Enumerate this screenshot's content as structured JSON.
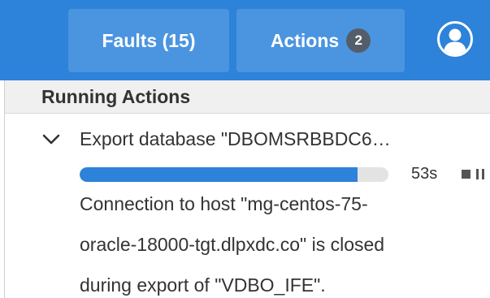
{
  "header": {
    "faults_label": "Faults (15)",
    "actions_label": "Actions",
    "actions_count": "2",
    "user_icon": "user-circle-icon",
    "colors": {
      "bar": "#2d82d9",
      "button": "#4b95e0",
      "badge": "#545e6b"
    }
  },
  "panel": {
    "section_title": "Running Actions",
    "action": {
      "expand_icon": "chevron-down-icon",
      "title": "Export database \"DBOMSRBBDC6…",
      "progress_percent": 90,
      "elapsed": "53s",
      "stop_icon": "stop-icon",
      "pause_icon": "pause-icon",
      "message_lines": [
        "Connection to host \"mg-centos-75-",
        "oracle-18000-tgt.dlpxdc.co\" is closed",
        "during export of \"VDBO_IFE\"."
      ]
    }
  }
}
